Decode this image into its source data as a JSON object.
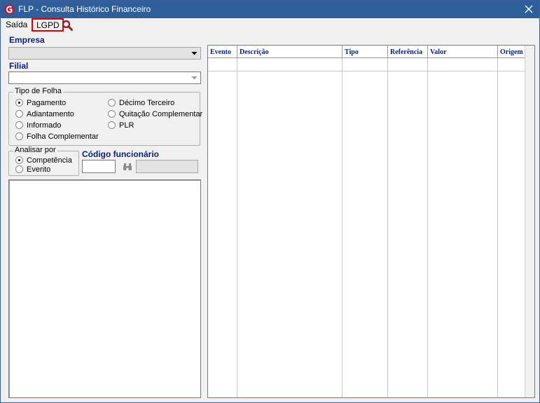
{
  "window": {
    "title": "FLP - Consulta Histórico Financeiro"
  },
  "menu": {
    "saida": "Saída",
    "lgpd": "LGPD",
    "search_icon": "magnifier-icon"
  },
  "empresa": {
    "label": "Empresa",
    "value": ""
  },
  "filial": {
    "label": "Filial",
    "value": ""
  },
  "tipo_folha": {
    "legend": "Tipo de Folha",
    "options": [
      {
        "label": "Pagamento",
        "checked": true
      },
      {
        "label": "Adiantamento",
        "checked": false
      },
      {
        "label": "Informado",
        "checked": false
      },
      {
        "label": "Folha Complementar",
        "checked": false
      },
      {
        "label": "Décimo Terceiro",
        "checked": false
      },
      {
        "label": "Quitação Complementar",
        "checked": false
      },
      {
        "label": "PLR",
        "checked": false
      }
    ]
  },
  "analisar_por": {
    "legend": "Analisar por",
    "options": [
      {
        "label": "Competência",
        "checked": true
      },
      {
        "label": "Evento",
        "checked": false
      }
    ]
  },
  "codigo_funcionario": {
    "label": "Código funcionário",
    "code_value": "",
    "name_value": "",
    "lookup_icon": "binoculars-icon"
  },
  "grid": {
    "columns": [
      "Evento",
      "Descrição",
      "Tipo",
      "Referência",
      "Valor",
      "Origem"
    ]
  },
  "colors": {
    "titlebar": "#2f5f9a",
    "label_blue": "#0a1f7a",
    "highlight_red": "#e00000"
  }
}
